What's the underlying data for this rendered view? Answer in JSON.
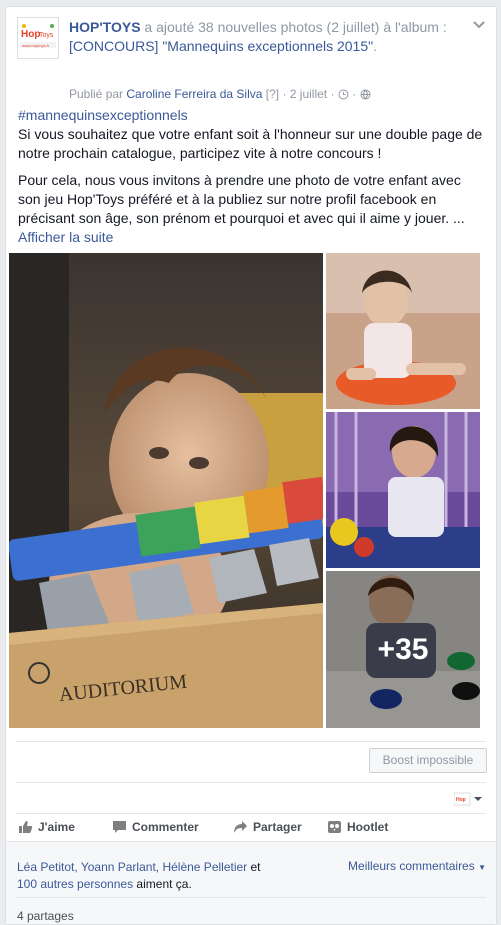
{
  "header": {
    "page_name": "HOP'TOYS",
    "action_text": " a ajouté 38 nouvelles photos (2 juillet) à l'album : ",
    "album_name": "[CONCOURS] \"Mannequins exceptionnels 2015\"",
    "album_suffix": ".",
    "published_by": "Publié par ",
    "author": "Caroline Ferreira da Silva",
    "help": " [?] ",
    "date": "· 2 juillet ·",
    "logo_text": "Hop'Toys",
    "logo_url_text": "www.hoptoys.fr"
  },
  "body": {
    "hashtag": "#mannequinsexceptionnels",
    "para1": "Si vous souhaitez que votre enfant soit à l'honneur sur une double page de notre prochain catalogue, participez vite à notre concours !",
    "para2": "Pour cela, nous vous invitons à prendre une photo de votre enfant avec son jeu Hop'Toys préféré et à la publiez sur notre profil facebook en précisant son âge, son prénom et pourquoi et avec qui il aime y jouer. ...",
    "see_more": "Afficher la suite"
  },
  "photos": {
    "more_count": "+35",
    "toy_brand": "AUDITORIUM"
  },
  "boost_label": "Boost impossible",
  "actions": {
    "like": "J'aime",
    "comment": "Commenter",
    "share": "Partager",
    "hootlet": "Hootlet"
  },
  "likes": {
    "names": "Léa Petitot, Yoann Parlant, Hélène Pelletier",
    "and": " et ",
    "others": "100 autres personnes",
    "suffix": " aiment ça."
  },
  "best_comments": "Meilleurs commentaires",
  "shares": "4 partages",
  "colors": {
    "link": "#3b5998",
    "muted": "#9197a3",
    "background": "#e9ebee"
  }
}
